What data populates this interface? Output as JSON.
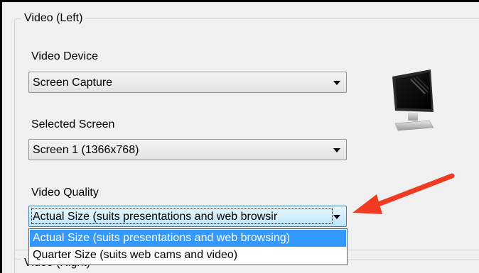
{
  "video_left": {
    "group_title": "Video (Left)",
    "device": {
      "label": "Video Device",
      "value": "Screen Capture"
    },
    "screen": {
      "label": "Selected Screen",
      "value": "Screen 1 (1366x768)"
    },
    "quality": {
      "label": "Video Quality",
      "value": "Actual Size (suits presentations and web browsir",
      "options": [
        "Actual Size (suits presentations and web browsing)",
        "Quarter Size (suits web cams and video)"
      ],
      "selected_index": 0
    },
    "preview_icon": "monitor-icon"
  },
  "video_right": {
    "group_title": "Video (Right)"
  },
  "annotation": {
    "arrow_color": "#f03a22",
    "icon": "red-arrow-icon"
  },
  "colors": {
    "highlight": "#3399ff",
    "background": "#f0f0f0"
  }
}
